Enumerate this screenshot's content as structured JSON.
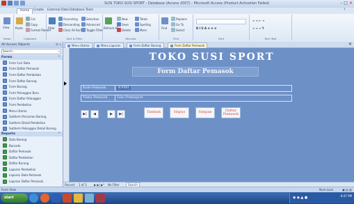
{
  "window": {
    "title": "SUSI TOKO SUSI SPORT : Database (Access 2007) - Microsoft Access (Product Activation Failed)"
  },
  "ribbon": {
    "tabs": [
      "Home",
      "Create",
      "External Data",
      "Database Tools"
    ],
    "groups": {
      "views": {
        "label": "Views",
        "button": "View"
      },
      "clipboard": {
        "label": "Clipboard",
        "cut": "Cut",
        "copy": "Copy",
        "paste": "Paste",
        "format_painter": "Format Painter"
      },
      "sort_filter": {
        "label": "Sort & Filter",
        "filter": "Filter",
        "ascending": "Ascending",
        "descending": "Descending",
        "clear_sort": "Clear All Sorts",
        "selection": "Selection",
        "advanced": "Advanced",
        "toggle": "Toggle Filter"
      },
      "records": {
        "label": "Records",
        "refresh": "Refresh All",
        "new": "New",
        "save": "Save",
        "delete": "Delete",
        "totals": "Totals",
        "spelling": "Spelling",
        "more": "More"
      },
      "find": {
        "label": "Find",
        "find": "Find",
        "replace": "Replace",
        "goto": "Go To",
        "select": "Select"
      },
      "font": {
        "label": "Font"
      },
      "rich_text": {
        "label": "Rich Text"
      }
    }
  },
  "nav": {
    "header": "All Access Objects",
    "search_placeholder": "Search...",
    "sections": [
      {
        "label": "Forms",
        "items": [
          "Form Cari Data",
          "Form Daftar Pemasok",
          "Form Daftar Pembelian",
          "Form Daftar Barang",
          "Form Barang",
          "Form Pelanggan Baru",
          "Form Daftar Pelanggan",
          "Form Pembelian",
          "Menu Utama",
          "Subform Pencarian Barang",
          "Subform Detail Pembelian",
          "Subform Pelanggan Detail Barang"
        ]
      },
      {
        "label": "Reports",
        "items": [
          "Data Barang",
          "Barcode",
          "Daftar Pemasok",
          "Daftar Pembelian",
          "Daftar Barang",
          "Laporan Pembelian",
          "Laporan Data Pemasok",
          "Laporan Daftar Pemasok"
        ]
      }
    ]
  },
  "doc_tabs": [
    "Menu Utama",
    "Menu Laporan",
    "Form Daftar Barang",
    "Form Daftar Pemasok"
  ],
  "form": {
    "title": "TOKO SUSI SPORT",
    "subtitle": "Form Daftar Pemasok",
    "fields": [
      {
        "label": "Kode Pemasok",
        "value": "K-P001"
      },
      {
        "label": "Nama Pemasok",
        "value": "Toko Primasport"
      }
    ],
    "nav_buttons": [
      "first",
      "previous",
      "next",
      "last"
    ],
    "commands": [
      "Tambah",
      "Hapus",
      "Simpan",
      "Daftar Pemasok"
    ]
  },
  "record_bar": {
    "prefix": "Record:",
    "position": "1 of 3",
    "filter": "No Filter",
    "search": "Search"
  },
  "status": {
    "left": "Form View",
    "right": "Num Lock"
  },
  "taskbar": {
    "start": "start",
    "clock": "8:47 PM"
  },
  "colors": {
    "form_bg": "#6d90c7",
    "title_text": "#ffffff",
    "command_text": "#d0453c",
    "active_tab": "#fff4c8"
  }
}
